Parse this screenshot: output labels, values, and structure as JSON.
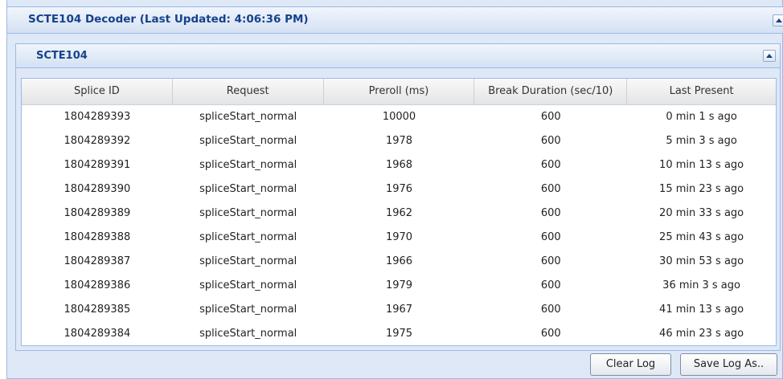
{
  "decoder": {
    "title": "SCTE104 Decoder (Last Updated: 4:06:36 PM)"
  },
  "section": {
    "title": "SCTE104"
  },
  "table": {
    "columns": [
      "Splice ID",
      "Request",
      "Preroll (ms)",
      "Break Duration (sec/10)",
      "Last Present"
    ],
    "rows": [
      [
        "1804289393",
        "spliceStart_normal",
        "10000",
        "600",
        "0 min 1 s ago"
      ],
      [
        "1804289392",
        "spliceStart_normal",
        "1978",
        "600",
        "5 min 3 s ago"
      ],
      [
        "1804289391",
        "spliceStart_normal",
        "1968",
        "600",
        "10 min 13 s ago"
      ],
      [
        "1804289390",
        "spliceStart_normal",
        "1976",
        "600",
        "15 min 23 s ago"
      ],
      [
        "1804289389",
        "spliceStart_normal",
        "1962",
        "600",
        "20 min 33 s ago"
      ],
      [
        "1804289388",
        "spliceStart_normal",
        "1970",
        "600",
        "25 min 43 s ago"
      ],
      [
        "1804289387",
        "spliceStart_normal",
        "1966",
        "600",
        "30 min 53 s ago"
      ],
      [
        "1804289386",
        "spliceStart_normal",
        "1979",
        "600",
        "36 min 3 s ago"
      ],
      [
        "1804289385",
        "spliceStart_normal",
        "1967",
        "600",
        "41 min 13 s ago"
      ],
      [
        "1804289384",
        "spliceStart_normal",
        "1975",
        "600",
        "46 min 23 s ago"
      ]
    ]
  },
  "buttons": {
    "clear_label": "Clear Log",
    "save_label": "Save Log As.."
  },
  "icons": {
    "collapse": "collapse-up-icon"
  },
  "colors": {
    "header_text": "#15428b",
    "panel_border": "#99bbe8",
    "panel_bg": "#dfe8f6"
  }
}
